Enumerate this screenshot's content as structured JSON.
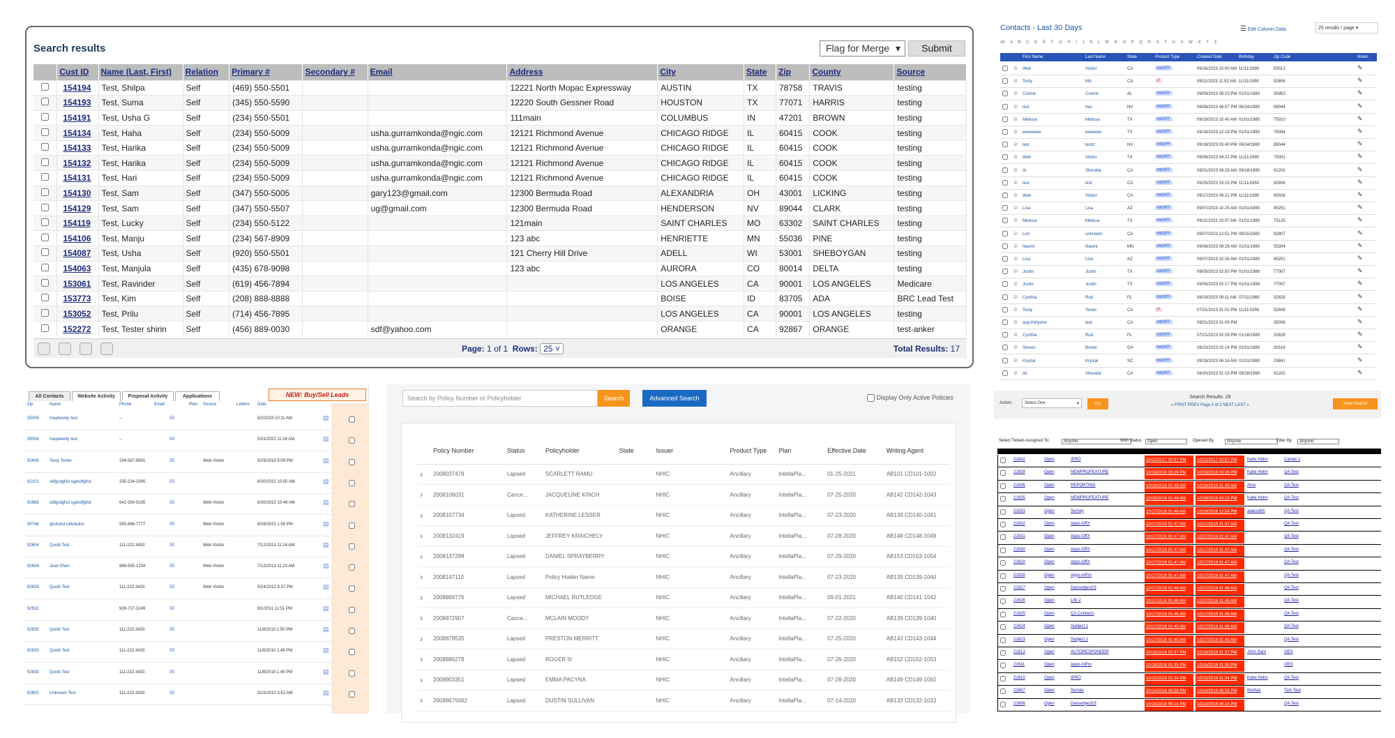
{
  "search_results": {
    "title": "Search results",
    "flag_select": "Flag for Merge",
    "submit": "Submit",
    "columns": [
      "Cust ID",
      "Name (Last, First)",
      "Relation",
      "Primary #",
      "Secondary #",
      "Email",
      "Address",
      "City",
      "State",
      "Zip",
      "County",
      "Source"
    ],
    "rows": [
      [
        "154194",
        "Test, Shilpa",
        "Self",
        "(469) 550-5501",
        "",
        "",
        "12221 North Mopac Expressway",
        "AUSTIN",
        "TX",
        "78758",
        "TRAVIS",
        "testing"
      ],
      [
        "154193",
        "Test, Suma",
        "Self",
        "(345) 550-5590",
        "",
        "",
        "12220 South Gessner Road",
        "HOUSTON",
        "TX",
        "77071",
        "HARRIS",
        "testing"
      ],
      [
        "154191",
        "Test, Usha G",
        "Self",
        "(234) 550-5501",
        "",
        "",
        "111main",
        "COLUMBUS",
        "IN",
        "47201",
        "BROWN",
        "testing"
      ],
      [
        "154134",
        "Test, Haha",
        "Self",
        "(234) 550-5009",
        "",
        "usha.gurramkonda@ngic.com",
        "12121 Richmond Avenue",
        "CHICAGO RIDGE",
        "IL",
        "60415",
        "COOK",
        "testing"
      ],
      [
        "154133",
        "Test, Harika",
        "Self",
        "(234) 550-5009",
        "",
        "usha.gurramkonda@ngic.com",
        "12121 Richmond Avenue",
        "CHICAGO RIDGE",
        "IL",
        "60415",
        "COOK",
        "testing"
      ],
      [
        "154132",
        "Test, Harika",
        "Self",
        "(234) 550-5009",
        "",
        "usha.gurramkonda@ngic.com",
        "12121 Richmond Avenue",
        "CHICAGO RIDGE",
        "IL",
        "60415",
        "COOK",
        "testing"
      ],
      [
        "154131",
        "Test, Hari",
        "Self",
        "(234) 550-5009",
        "",
        "usha.gurramkonda@ngic.com",
        "12121 Richmond Avenue",
        "CHICAGO RIDGE",
        "IL",
        "60415",
        "COOK",
        "testing"
      ],
      [
        "154130",
        "Test, Sam",
        "Self",
        "(347) 550-5005",
        "",
        "gary123@gmail.com",
        "12300 Bermuda Road",
        "ALEXANDRIA",
        "OH",
        "43001",
        "LICKING",
        "testing"
      ],
      [
        "154129",
        "Test, Sam",
        "Self",
        "(347) 550-5507",
        "",
        "ug@gmail.com",
        "12300 Bermuda Road",
        "HENDERSON",
        "NV",
        "89044",
        "CLARK",
        "testing"
      ],
      [
        "154119",
        "Test, Lucky",
        "Self",
        "(234) 550-5122",
        "",
        "",
        "121main",
        "SAINT CHARLES",
        "MO",
        "63302",
        "SAINT CHARLES",
        "testing"
      ],
      [
        "154106",
        "Test, Manju",
        "Self",
        "(234) 567-8909",
        "",
        "",
        "123 abc",
        "HENRIETTE",
        "MN",
        "55036",
        "PINE",
        "testing"
      ],
      [
        "154087",
        "Test, Usha",
        "Self",
        "(920) 550-5501",
        "",
        "",
        "121 Cherry Hill Drive",
        "ADELL",
        "WI",
        "53001",
        "SHEBOYGAN",
        "testing"
      ],
      [
        "154063",
        "Test, Manjula",
        "Self",
        "(435) 678-9098",
        "",
        "",
        "123 abc",
        "AURORA",
        "CO",
        "80014",
        "DELTA",
        "testing"
      ],
      [
        "153061",
        "Test, Ravinder",
        "Self",
        "(619) 456-7894",
        "",
        "",
        "",
        "LOS ANGELES",
        "CA",
        "90001",
        "LOS ANGELES",
        "Medicare"
      ],
      [
        "153773",
        "Test, Kim",
        "Self",
        "(208) 888-8888",
        "",
        "",
        "",
        "BOISE",
        "ID",
        "83705",
        "ADA",
        "BRC Lead Test"
      ],
      [
        "153052",
        "Test, Prilu",
        "Self",
        "(714) 456-7895",
        "",
        "",
        "",
        "LOS ANGELES",
        "CA",
        "90001",
        "LOS ANGELES",
        "testing"
      ],
      [
        "152272",
        "Test, Tester shirin",
        "Self",
        "(456) 889-0030",
        "",
        "sdf@yahoo.com",
        "",
        "ORANGE",
        "CA",
        "92867",
        "ORANGE",
        "test-anker"
      ]
    ],
    "page_label": "Page:",
    "page_current": "1",
    "page_of": "of",
    "page_total": "1",
    "rows_label": "Rows:",
    "rows_value": "25",
    "total_label": "Total Results:",
    "total_value": "17"
  },
  "contacts": {
    "title": "Contacts - Last 30 Days",
    "edit_label": "Edit Column Data",
    "per_page": "25 results / page",
    "alphabet": "All  A  B  C  D  E  F  G  H  I  J  K  L  M  N  O  P  Q  R  S  T  U  V  W  X  Y  Z",
    "columns": [
      "First Name",
      "Last Name",
      "State",
      "Product Type",
      "Created Date",
      "Birthday",
      "Zip Code",
      "Notes"
    ],
    "rows": [
      [
        "Web",
        "Visitor",
        "CA",
        "M/OFF",
        "09/26/2023 10:00 AM",
        "11/11/1990",
        "93012"
      ],
      [
        "Testy",
        "MA",
        "CA",
        "P",
        "08/11/2023 11:53 AM",
        "11/11/1950",
        "92606"
      ],
      [
        "Connie",
        "Connie",
        "AL",
        "M/OFF",
        "09/09/2023 09:23 PM",
        "01/01/1980",
        "35953"
      ],
      [
        "test",
        "tres",
        "NV",
        "M/OFF",
        "09/08/2023 08:57 PM",
        "06/24/1980",
        "89044"
      ],
      [
        "Melissa",
        "Melissa",
        "TX",
        "M/OFF",
        "09/19/2023 10:40 AM",
        "01/01/1980",
        "75010"
      ],
      [
        "eeeeeeee",
        "eeeeeee",
        "TX",
        "M/OFF",
        "09/18/2023 12:18 PM",
        "01/01/1980",
        "75094"
      ],
      [
        "test",
        "testd",
        "NV",
        "M/OFF",
        "09/18/2023 03:40 PM",
        "06/24/1980",
        "89044"
      ],
      [
        "Web",
        "Visitor",
        "TX",
        "M/OFF",
        "09/08/2023 04:21 PM",
        "11/11/1990",
        "75001"
      ],
      [
        "Al",
        "Sherafat",
        "CA",
        "M/OFF",
        "08/31/2023 09:29 AM",
        "09/18/1990",
        "91202"
      ],
      [
        "test",
        "test",
        "CA",
        "M/OFF",
        "09/25/2023 03:15 PM",
        "11/11/1950",
        "92606"
      ],
      [
        "Web",
        "Visitor",
        "CA",
        "M/OFF",
        "09/17/2023 09:21 PM",
        "11/11/1990",
        "90026"
      ],
      [
        "Lisa",
        "Lisa",
        "AZ",
        "M/OFF",
        "09/07/2023 10:25 AM",
        "01/01/1980",
        "85251"
      ],
      [
        "Melissa",
        "Melissa",
        "TX",
        "M/OFF",
        "09/11/2023 10:07 AM",
        "01/01/1980",
        "75125"
      ],
      [
        "Lori",
        "unknown",
        "CA",
        "M/OFF",
        "09/07/2023 12:51 PM",
        "08/15/1980",
        "92807"
      ],
      [
        "Naomi",
        "Naomi",
        "MN",
        "M/OFF",
        "09/08/2023 08:28 AM",
        "01/01/1980",
        "55304"
      ],
      [
        "Lisa",
        "Lisa",
        "AZ",
        "M/OFF",
        "09/07/2023 10:26 AM",
        "01/01/1980",
        "85251"
      ],
      [
        "Justin",
        "Justin",
        "TX",
        "M/OFF",
        "09/05/2023 02:50 PM",
        "01/01/1988",
        "77007"
      ],
      [
        "Justin",
        "Justin",
        "TX",
        "M/OFF",
        "09/05/2023 02:17 PM",
        "01/01/1988",
        "77007"
      ],
      [
        "Cynthia",
        "Rod",
        "FL",
        "M/OFF",
        "08/18/2023 09:11 AM",
        "07/11/1989",
        "32829"
      ],
      [
        "Testy",
        "Tester",
        "CA",
        "P",
        "07/31/2023 01:02 PM",
        "11/11/1956",
        "92606"
      ],
      [
        "aug thirtyone",
        "test",
        "CA",
        "M/OFF",
        "08/31/2023 01:09 PM",
        "",
        "35006"
      ],
      [
        "Cynthia",
        "Rod",
        "FL",
        "M/OFF",
        "07/21/2023 02:29 PM",
        "01/18/1989",
        "32829"
      ],
      [
        "Steven",
        "Brown",
        "GA",
        "M/OFF",
        "08/23/2023 02:14 PM",
        "01/01/1980",
        "30318"
      ],
      [
        "Krystal",
        "Krystal",
        "SC",
        "M/OFF",
        "09/18/2023 06:16 AM",
        "01/01/1980",
        "29841"
      ],
      [
        "Ali",
        "Sherafat",
        "CA",
        "M/OFF",
        "08/30/2023 01:19 PM",
        "09/18/1990",
        "91202"
      ]
    ]
  },
  "activity": {
    "tabs": [
      "All Contacts",
      "Website Activity",
      "Proposal Activity",
      "Applications"
    ],
    "banner": "NEW: Buy/Sell Leads",
    "columns": [
      "Zip",
      "Name",
      "Phone",
      "Email",
      "Plan",
      "Source",
      "Letters",
      "Date"
    ],
    "rows": [
      [
        "35006",
        "maytwenty test",
        "--",
        "",
        "",
        "6/2/2023 10:11 AM"
      ],
      [
        "35006",
        "maytwenty test",
        "--",
        "",
        "",
        "5/31/2023 11:26 AM"
      ],
      [
        "92606",
        "Testy Tester",
        "234-567-8901",
        "",
        "Web Visitor",
        "5/29/2018 5:09 PM"
      ],
      [
        "92101",
        "sdfgsdgfsd sgdsdfgfsd",
        "235-234-2345",
        "",
        "",
        "6/30/2015 10:50 AM"
      ],
      [
        "92868",
        "sdfgsdgfsd sgdsdfgfsd",
        "642-254-5235",
        "",
        "Web Visitor",
        "6/30/2015 10:46 AM"
      ],
      [
        "90746",
        "gtuituitui tuituituitui",
        "555-666-7777",
        "",
        "Web Visitor",
        "6/26/2015 1:58 PM"
      ],
      [
        "92604",
        "Quotit Test",
        "111-222-3433",
        "",
        "Web Visitor",
        "7/12/2013 11:24 AM"
      ],
      [
        "92604",
        "Jean Shen",
        "888-555-1234",
        "",
        "Web Visitor",
        "7/12/2013 11:23 AM"
      ],
      [
        "92833",
        "Quotit Test",
        "111-222-3433",
        "",
        "Web Visitor",
        "5/24/2012 8:37 PM"
      ],
      [
        "92532",
        "",
        "928-717-3249",
        "",
        "",
        "9/1/2011 11:51 PM"
      ],
      [
        "92835",
        "Quotit Test",
        "111-222-3433",
        "",
        "",
        "11/8/2010 1:50 PM"
      ],
      [
        "92833",
        "Quotit Test",
        "111-222-3433",
        "",
        "",
        "11/8/2010 1:49 PM"
      ],
      [
        "92833",
        "Quotit Test",
        "111-222-3433",
        "",
        "",
        "11/8/2010 1:49 PM"
      ],
      [
        "92602",
        "Unknown Test",
        "111-222-3433",
        "",
        "",
        "3/15/2010 3:52 AM"
      ]
    ]
  },
  "policies": {
    "search_placeholder": "Search by Policy Number or Policyholder",
    "search_btn": "Search",
    "advanced_btn": "Advanced Search",
    "active_only": "Display Only Active Policies",
    "columns": [
      "Policy Number",
      "Status",
      "Policyholder",
      "State",
      "Issuer",
      "Product Type",
      "Plan",
      "Effective Date",
      "Writing Agent"
    ],
    "rows": [
      [
        "2008037478",
        "Lapsed",
        "SCARLETT RAMU",
        "",
        "NHIC",
        "Ancillary",
        "IntellaPla...",
        "01-25-2021",
        "AB101 CD101-1002"
      ],
      [
        "2008106031",
        "Cance...",
        "JACQUELINE KINCH",
        "",
        "NHIC",
        "Ancillary",
        "IntellaPla...",
        "07-25-2020",
        "AB142 CD142-1043"
      ],
      [
        "2008107734",
        "Lapsed",
        "KATHERINE LESSER",
        "",
        "NHIC",
        "Ancillary",
        "IntellaPla...",
        "07-23-2020",
        "AB139 CD140-1041"
      ],
      [
        "2008132419",
        "Lapsed",
        "JEFFREY KRAICHELY",
        "",
        "NHIC",
        "Ancillary",
        "IntellaPla...",
        "07-28-2020",
        "AB148 CD148-1049"
      ],
      [
        "2008137288",
        "Lapsed",
        "DANIEL SPRAYBERRY",
        "",
        "NHIC",
        "Ancillary",
        "IntellaPla...",
        "07-29-2020",
        "AB153 CD153-1054"
      ],
      [
        "2008147110",
        "Lapsed",
        "Policy Holder Name",
        "",
        "NHIC",
        "Ancillary",
        "IntellaPla...",
        "07-23-2020",
        "AB139 CD139-1040"
      ],
      [
        "2008869776",
        "Lapsed",
        "MICHAEL RUTLEDGE",
        "",
        "NHIC",
        "Ancillary",
        "IntellaPla...",
        "09-01-2021",
        "AB140 CD141-1042"
      ],
      [
        "2008872907",
        "Cance...",
        "MCLAIN MOODY",
        "",
        "NHIC",
        "Ancillary",
        "IntellaPla...",
        "07-22-2020",
        "AB139 CD139-1040"
      ],
      [
        "2008879535",
        "Lapsed",
        "PRESTON MERRITT",
        "",
        "NHIC",
        "Ancillary",
        "IntellaPla...",
        "07-25-2020",
        "AB143 CD143-1044"
      ],
      [
        "2008886279",
        "Lapsed",
        "ROGER III",
        "",
        "NHIC",
        "Ancillary",
        "IntellaPla...",
        "07-26-2020",
        "AB152 CD152-1053"
      ],
      [
        "2008903351",
        "Lapsed",
        "EMMA PACYNA",
        "",
        "NHIC",
        "Ancillary",
        "IntellaPla...",
        "07-28-2020",
        "AB149 CD149-1050"
      ],
      [
        "20098675662",
        "Lapsed",
        "DUSTIN SULLIVAN",
        "",
        "NHIC",
        "Ancillary",
        "IntellaPla...",
        "07-14-2020",
        "AB132 CD132-1033"
      ]
    ]
  },
  "actionbar": {
    "action_label": "Action:",
    "action_select": "Select One",
    "go": "Go",
    "results": "Search Results: 29",
    "nav": "« FIRST   PREV   Page 1 of 2   NEXT   LAST »",
    "save": "Save Search"
  },
  "tickets": {
    "filters": [
      "Select Tickets Assigned To:",
      "Anyone",
      "With Status",
      "Open",
      "Opened By",
      "Anyone",
      "Filter By",
      "Anyone"
    ],
    "rows": [
      [
        "21642",
        "Open",
        "IPRO",
        "10/12/2017 02:57 PM",
        "10/12/2017 02:57 PM",
        "Katie Hohn",
        "Carrier 1"
      ],
      [
        "21639",
        "Open",
        "NEWPROFEATURE",
        "10/19/2016 03:26 PM",
        "10/19/2016 03:26 PM",
        "Katie Hohn",
        "QA Test"
      ],
      [
        "21636",
        "Open",
        "REPORTING",
        "10/19/2016 01:49 AM",
        "10/19/2016 01:49 AM",
        "Amo",
        "QA Test"
      ],
      [
        "21635",
        "Open",
        "NEWPROFEATURE",
        "10/19/2016 01:48 AM",
        "10/19/2016 03:23 PM",
        "Katie Hohn",
        "QA Test"
      ],
      [
        "21633",
        "Open",
        "Survey",
        "10/17/2016 01:48 AM",
        "10/18/2016 12:54 PM",
        "aaaccdvh",
        "QA Test"
      ],
      [
        "21632",
        "Open",
        "Apps-OffX",
        "10/17/2016 01:47 AM",
        "10/17/2016 01:47 AM",
        "",
        "QA Test"
      ],
      [
        "21631",
        "Open",
        "Apps-OffX",
        "10/17/2016 01:47 AM",
        "10/17/2016 01:47 AM",
        "",
        "QA Test"
      ],
      [
        "21630",
        "Open",
        "Apps-OffX",
        "10/17/2016 01:47 AM",
        "10/17/2016 01:47 AM",
        "",
        "QA Test"
      ],
      [
        "21629",
        "Open",
        "Apps-OffX",
        "10/17/2016 01:47 AM",
        "10/17/2016 01:47 AM",
        "",
        "QA Test"
      ],
      [
        "21628",
        "Open",
        "Apps-mPro",
        "10/17/2016 01:47 AM",
        "10/17/2016 01:47 AM",
        "",
        "QA Test"
      ],
      [
        "21627",
        "Open",
        "Dansubject23",
        "10/17/2016 01:46 AM",
        "10/17/2016 01:46 AM",
        "",
        "QA Test"
      ],
      [
        "21626",
        "Open",
        "Life 2",
        "10/17/2016 01:46 AM",
        "10/17/2016 01:46 AM",
        "",
        "QA Test"
      ],
      [
        "21625",
        "Open",
        "Q1-Contacts",
        "10/17/2016 01:46 AM",
        "10/17/2016 01:46 AM",
        "",
        "QA Test"
      ],
      [
        "21624",
        "Open",
        "Subject 1",
        "10/17/2016 01:45 AM",
        "10/17/2016 01:45 AM",
        "",
        "QA Test"
      ],
      [
        "21623",
        "Open",
        "Subject 1",
        "10/17/2016 01:45 AM",
        "10/17/2016 01:45 AM",
        "",
        "QA Test"
      ],
      [
        "21613",
        "Open",
        "AUTORESPONDER",
        "10/16/2016 01:37 PM",
        "10/16/2016 01:37 PM",
        "John Sant",
        "OES"
      ],
      [
        "21611",
        "Open",
        "Apps-mPro",
        "10/16/2016 01:35 PM",
        "10/16/2016 01:35 PM",
        "",
        "OES"
      ],
      [
        "21610",
        "Open",
        "IPRO",
        "10/15/2016 01:34 PM",
        "10/15/2016 01:34 PM",
        "Katie Hohn",
        "QA Test"
      ],
      [
        "21607",
        "Open",
        "Survey",
        "10/14/2016 06:58 PM",
        "10/14/2016 06:58 PM",
        "thomas",
        "Tom Test"
      ],
      [
        "21606",
        "Open",
        "Dansubject23",
        "10/14/2016 06:14 PM",
        "10/14/2016 06:14 PM",
        "",
        "QA Test"
      ]
    ]
  }
}
